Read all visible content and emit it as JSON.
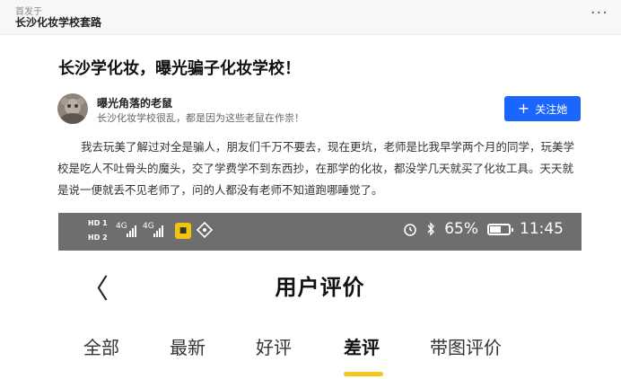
{
  "header": {
    "published_in": "首发于",
    "source_name": "长沙化妆学校套路",
    "more_icon": "more-dots-icon"
  },
  "article": {
    "title": "长沙学化妆，曝光骗子化妆学校！",
    "author": {
      "name": "曝光角落的老鼠",
      "bio": "长沙化妆学校很乱，都是因为这些老鼠在作祟！",
      "avatar_icon": "avatar-photo"
    },
    "follow_label": "关注她",
    "body": "我去玩美了解过对全是骗人，朋友们千万不要去，现在更坑，老师是比我早学两个月的同学，玩美学校是吃人不吐骨头的魔头，交了学费学不到东西抄，在那学的化妆，都没学几天就买了化妆工具。天天就是说一便就丢不见老师了，问的人都没有老师不知道跑哪睡觉了。"
  },
  "screenshot": {
    "status": {
      "hd1": "HD 1",
      "hd2": "HD 2",
      "signal1": "4G",
      "signal2": "4G",
      "battery": "65%",
      "time": "11:45"
    },
    "page_title": "用户评价",
    "tabs": [
      {
        "label": "全部"
      },
      {
        "label": "最新"
      },
      {
        "label": "好评"
      },
      {
        "label": "差评"
      },
      {
        "label": "带图评价"
      }
    ],
    "active_tab": "差评"
  },
  "colors": {
    "accent": "#1a66ff",
    "tab_underline": "#f5c518",
    "status_bar": "#6e6e6e"
  }
}
